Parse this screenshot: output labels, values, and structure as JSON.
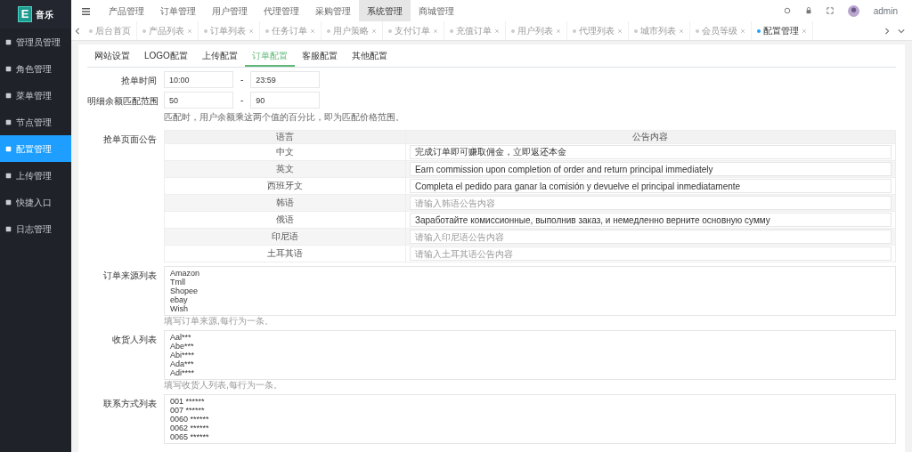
{
  "brand": {
    "logo": "E",
    "name": "音乐"
  },
  "sidebar": {
    "items": [
      {
        "label": "管理员管理",
        "selected": false
      },
      {
        "label": "角色管理",
        "selected": false
      },
      {
        "label": "菜单管理",
        "selected": false
      },
      {
        "label": "节点管理",
        "selected": false
      },
      {
        "label": "配置管理",
        "selected": true
      },
      {
        "label": "上传管理",
        "selected": false
      },
      {
        "label": "快捷入口",
        "selected": false
      },
      {
        "label": "日志管理",
        "selected": false
      }
    ]
  },
  "top_menu": [
    {
      "label": "产品管理",
      "selected": false
    },
    {
      "label": "订单管理",
      "selected": false
    },
    {
      "label": "用户管理",
      "selected": false
    },
    {
      "label": "代理管理",
      "selected": false
    },
    {
      "label": "采购管理",
      "selected": false
    },
    {
      "label": "系统管理",
      "selected": true
    },
    {
      "label": "商城管理",
      "selected": false
    }
  ],
  "user": {
    "name": "admin"
  },
  "page_tabs": [
    {
      "label": "后台首页",
      "selected": false,
      "closable": false
    },
    {
      "label": "产品列表",
      "selected": false,
      "closable": true
    },
    {
      "label": "订单列表",
      "selected": false,
      "closable": true
    },
    {
      "label": "任务订单",
      "selected": false,
      "closable": true
    },
    {
      "label": "用户策略",
      "selected": false,
      "closable": true
    },
    {
      "label": "支付订单",
      "selected": false,
      "closable": true
    },
    {
      "label": "充值订单",
      "selected": false,
      "closable": true
    },
    {
      "label": "用户列表",
      "selected": false,
      "closable": true
    },
    {
      "label": "代理列表",
      "selected": false,
      "closable": true
    },
    {
      "label": "城市列表",
      "selected": false,
      "closable": true
    },
    {
      "label": "会员等级",
      "selected": false,
      "closable": true
    },
    {
      "label": "配置管理",
      "selected": true,
      "closable": true
    }
  ],
  "config_tabs": [
    {
      "label": "网站设置",
      "selected": false
    },
    {
      "label": "LOGO配置",
      "selected": false
    },
    {
      "label": "上传配置",
      "selected": false
    },
    {
      "label": "订单配置",
      "selected": true
    },
    {
      "label": "客服配置",
      "selected": false
    },
    {
      "label": "其他配置",
      "selected": false
    }
  ],
  "grab_time": {
    "label": "抢单时间",
    "from": "10:00",
    "separator": "-",
    "to": "23:59"
  },
  "match_range": {
    "label": "明细余额匹配范围",
    "from": "50",
    "separator": "-",
    "to": "90",
    "help": "匹配时，用户余额乘这两个值的百分比，即为匹配价格范围。"
  },
  "notice": {
    "label": "抢单页面公告",
    "columns": [
      "语言",
      "公告内容"
    ],
    "rows": [
      {
        "language": "中文",
        "value": "完成订单即可赚取佣金，立即返还本金"
      },
      {
        "language": "英文",
        "value": "Earn commission upon completion of order and return principal immediately"
      },
      {
        "language": "西班牙文",
        "value": "Completa el pedido para ganar la comisión y devuelve el principal inmediatamente"
      },
      {
        "language": "韩语",
        "placeholder": "请输入韩语公告内容"
      },
      {
        "language": "俄语",
        "value": "Заработайте комиссионные, выполнив заказ, и немедленно верните основную сумму"
      },
      {
        "language": "印尼语",
        "placeholder": "请输入印尼语公告内容"
      },
      {
        "language": "土耳其语",
        "placeholder": "请输入土耳其语公告内容"
      }
    ]
  },
  "lists": [
    {
      "label": "订单来源列表",
      "lines": [
        "Amazon",
        "Tmll",
        "Shopee",
        "ebay",
        "Wish"
      ],
      "help": "填写订单来源,每行为一条。"
    },
    {
      "label": "收货人列表",
      "lines": [
        "Aal***",
        "Abe***",
        "Abi****",
        "Ada***",
        "Adi****"
      ],
      "help": "填写收货人列表,每行为一条。"
    },
    {
      "label": "联系方式列表",
      "lines": [
        "001 ******",
        "007 ******",
        "0060 ******",
        "0062 ******",
        "0065 ******"
      ]
    }
  ]
}
